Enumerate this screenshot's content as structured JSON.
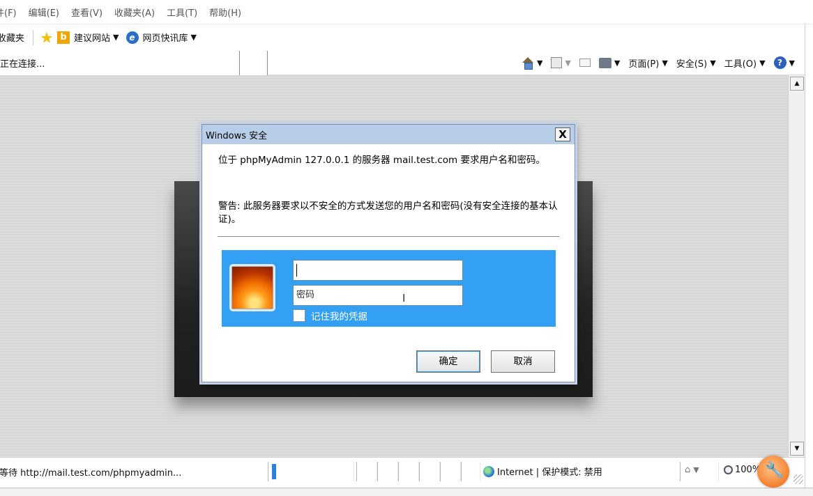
{
  "menu": {
    "items": [
      "件(F)",
      "编辑(E)",
      "查看(V)",
      "收藏夹(A)",
      "工具(T)",
      "帮助(H)"
    ]
  },
  "favorites": {
    "label": "收藏夹",
    "suggested_sites": "建议网站",
    "web_slice": "网页快讯库"
  },
  "tab": {
    "title": "正在连接..."
  },
  "commands": {
    "page": "页面(P)",
    "safety": "安全(S)",
    "tools": "工具(O)"
  },
  "dialog": {
    "title": "Windows 安全",
    "close": "X",
    "message": "位于 phpMyAdmin 127.0.0.1 的服务器 mail.test.com 要求用户名和密码。",
    "warning": "警告: 此服务器要求以不安全的方式发送您的用户名和密码(没有安全连接的基本认证)。",
    "username_value": "",
    "password_placeholder": "密码",
    "remember_label": "记住我的凭据",
    "ok_label": "确定",
    "cancel_label": "取消"
  },
  "status": {
    "text": "等待 http://mail.test.com/phpmyadmin...",
    "zone": "Internet | 保护模式: 禁用",
    "zoom": "100%"
  },
  "colors": {
    "cred_box": "#34a0f3",
    "title_bar": "#b8cde8"
  }
}
